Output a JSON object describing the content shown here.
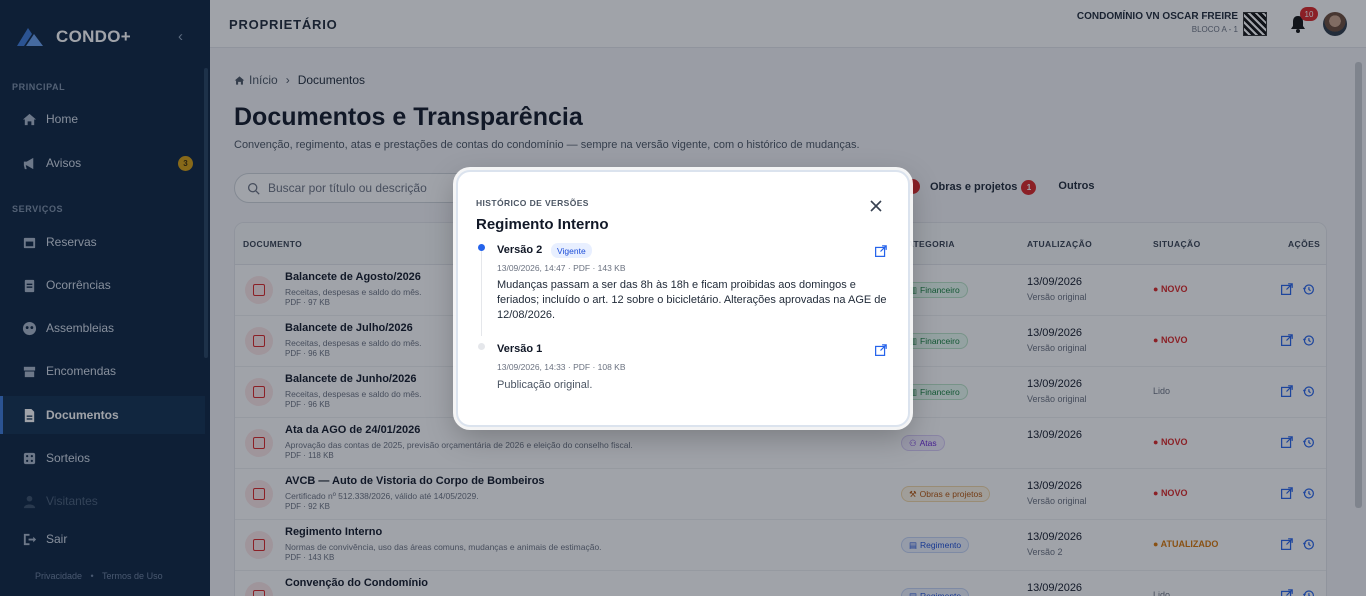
{
  "sidebar": {
    "brand": "CONDO+",
    "sections": {
      "principal": "PRINCIPAL",
      "servicos": "SERVIÇOS"
    },
    "items": [
      {
        "label": "Home",
        "icon": "home-icon"
      },
      {
        "label": "Avisos",
        "icon": "megaphone-icon",
        "badge": "3"
      },
      {
        "label": "Reservas",
        "icon": "calendar-icon"
      },
      {
        "label": "Ocorrências",
        "icon": "clipboard-icon"
      },
      {
        "label": "Assembleias",
        "icon": "people-icon"
      },
      {
        "label": "Encomendas",
        "icon": "box-icon"
      },
      {
        "label": "Documentos",
        "icon": "document-icon",
        "active": true
      },
      {
        "label": "Sorteios",
        "icon": "dice-icon"
      },
      {
        "label": "Visitantes",
        "icon": "visitor-icon"
      }
    ],
    "logout": "Sair",
    "footer": {
      "privacy": "Privacidade",
      "sep": "•",
      "terms": "Termos de Uso"
    }
  },
  "topbar": {
    "title": "PROPRIETÁRIO",
    "condo_name": "CONDOMÍNIO VN OSCAR FREIRE",
    "condo_unit": "BLOCO A - 1",
    "notifications": "10"
  },
  "breadcrumb": {
    "home": "Início",
    "sep": "›",
    "current": "Documentos"
  },
  "page": {
    "title": "Documentos e Transparência",
    "subtitle": "Convenção, regimento, atas e prestações de contas do condomínio — sempre na versão vigente, com o histórico de mudanças."
  },
  "search": {
    "placeholder": "Buscar por título ou descrição"
  },
  "filters": [
    {
      "label": "Obras e projetos",
      "badge": "1"
    },
    {
      "label": "Outros"
    }
  ],
  "table": {
    "headers": {
      "documento": "DOCUMENTO",
      "categoria": "CATEGORIA",
      "atualizacao": "ATUALIZAÇÃO",
      "situacao": "SITUAÇÃO",
      "acoes": "AÇÕES"
    },
    "rows": [
      {
        "title": "Balancete de Agosto/2026",
        "desc": "Receitas, despesas e saldo do mês.",
        "meta": "PDF · 97 KB",
        "category": "Financeiro",
        "date": "13/09/2026",
        "version": "Versão original",
        "status": "NOVO"
      },
      {
        "title": "Balancete de Julho/2026",
        "desc": "Receitas, despesas e saldo do mês.",
        "meta": "PDF · 96 KB",
        "category": "Financeiro",
        "date": "13/09/2026",
        "version": "Versão original",
        "status": "NOVO"
      },
      {
        "title": "Balancete de Junho/2026",
        "desc": "Receitas, despesas e saldo do mês.",
        "meta": "PDF · 96 KB",
        "category": "Financeiro",
        "date": "13/09/2026",
        "version": "Versão original",
        "status": "Lido"
      },
      {
        "title": "Ata da AGO de 24/01/2026",
        "desc": "Aprovação das contas de 2025, previsão orçamentária de 2026 e eleição do conselho fiscal.",
        "meta": "PDF · 118 KB",
        "category": "Atas",
        "date": "13/09/2026",
        "version": "",
        "status": "NOVO"
      },
      {
        "title": "AVCB — Auto de Vistoria do Corpo de Bombeiros",
        "desc": "Certificado nº 512.338/2026, válido até 14/05/2029.",
        "meta": "PDF · 92 KB",
        "category": "Obras e projetos",
        "date": "13/09/2026",
        "version": "Versão original",
        "status": "NOVO"
      },
      {
        "title": "Regimento Interno",
        "desc": "Normas de convivência, uso das áreas comuns, mudanças e animais de estimação.",
        "meta": "PDF · 143 KB",
        "category": "Regimento",
        "date": "13/09/2026",
        "version": "Versão 2",
        "status": "ATUALIZADO"
      },
      {
        "title": "Convenção do Condomínio",
        "desc": "",
        "meta": "",
        "category": "Regimento",
        "date": "13/09/2026",
        "version": "",
        "status": "Lido"
      }
    ]
  },
  "modal": {
    "eyebrow": "HISTÓRICO DE VERSÕES",
    "title": "Regimento Interno",
    "versions": [
      {
        "label": "Versão 2",
        "chip": "Vigente",
        "meta": "13/09/2026, 14:47 · PDF · 143 KB",
        "desc": "Mudanças passam a ser das 8h às 18h e ficam proibidas aos domingos e feriados; incluído o art. 12 sobre o bicicletário. Alterações aprovadas na AGE de 12/08/2026."
      },
      {
        "label": "Versão 1",
        "meta": "13/09/2026, 14:33 · PDF · 108 KB",
        "desc": "Publicação original."
      }
    ]
  },
  "colors": {
    "sidebar": "#0c2440",
    "accent": "#2563eb",
    "danger": "#dc2626",
    "warning": "#d97706"
  }
}
